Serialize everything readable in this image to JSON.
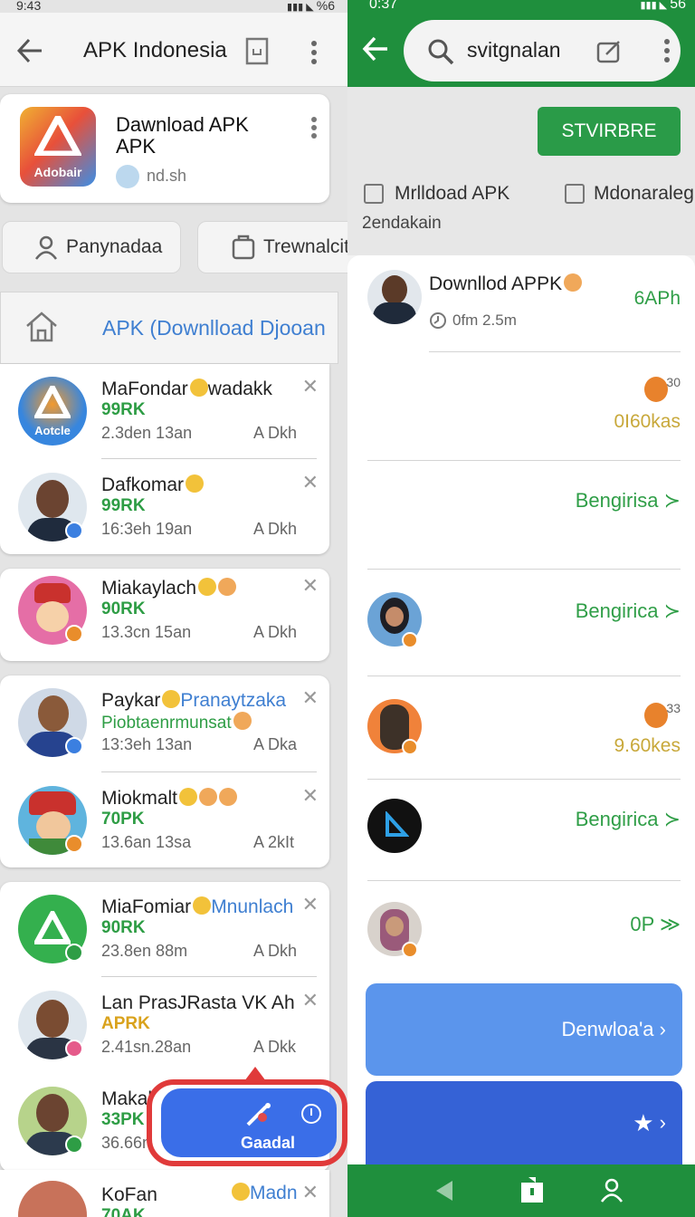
{
  "left": {
    "status": {
      "time": "9:43",
      "battery": "%6"
    },
    "title": "APK Indonesia",
    "top_card": {
      "title_line1": "Dawnload APK",
      "title_line2": "APK",
      "sub": "nd.sh",
      "icon_label": "Adobair"
    },
    "chips": [
      "Panynadaa",
      "Trewnalcit"
    ],
    "section_title": "APK (Downlload Djooan",
    "rows": [
      {
        "name": "MaFondar",
        "name_suffix": "wadakk",
        "sub": "99RK",
        "time": "2.3den 13an",
        "size": "A Dkh",
        "avatar_label": "Aotcle",
        "sub_color": "#2e9d45"
      },
      {
        "name": "Dafkomar",
        "name_suffix": "",
        "sub": "99RK",
        "time": "16:3eh 19an",
        "size": "A Dkh",
        "sub_color": "#2e9d45"
      },
      {
        "name": "Miakaylach",
        "name_suffix": "",
        "sub": "90RK",
        "time": "13.3cn 15an",
        "size": "A Dkh",
        "sub_color": "#2e9d45"
      },
      {
        "name": "Paykar",
        "name_suffix": "Pranaytzaka",
        "sub": "Piobtaenrmunsat",
        "time": "13:3eh 13an",
        "size": "A Dka",
        "sub_color": "#2e9d45"
      },
      {
        "name": "Miokmalt",
        "name_suffix": "",
        "sub": "70PK",
        "time": "13.6an 13sa",
        "size": "A 2kIt",
        "sub_color": "#2e9d45"
      },
      {
        "name": "MiaFomiar",
        "name_suffix": "Mnunlach",
        "sub": "90RK",
        "time": "23.8en 88m",
        "size": "A Dkh",
        "sub_color": "#2e9d45"
      },
      {
        "name": "Lan PrasJRasta VK Ah",
        "name_suffix": "",
        "sub": "APRK",
        "time": "2.41sn.28an",
        "size": "A Dkk",
        "sub_color": "#d9a21c"
      },
      {
        "name": "Makal",
        "name_suffix": "",
        "sub": "33PK",
        "time": "36.66n",
        "size": "",
        "sub_color": "#2e9d45"
      },
      {
        "name": "KoFan",
        "name_suffix": "Madn",
        "sub": "70AK",
        "time": "",
        "size": "",
        "sub_color": "#2e9d45"
      }
    ],
    "fab_label": "Gaadal"
  },
  "right": {
    "status": {
      "time": "0:37",
      "battery": "56"
    },
    "search_value": "svitgnalan",
    "top_button": "STVIRBRE",
    "checks": [
      "Mrlldoad APK",
      "Mdonaraleg"
    ],
    "subtext": "2endakain",
    "item": {
      "title": "Downllod APPK",
      "right": "6APh",
      "meta": "0fm 2.5m"
    },
    "entries": [
      {
        "type": "stat",
        "count": "30",
        "value": "0I60kas"
      },
      {
        "type": "link",
        "label": "Bengirisa"
      },
      {
        "type": "link",
        "label": "Bengirica"
      },
      {
        "type": "stat",
        "count": "33",
        "value": "9.60kes"
      },
      {
        "type": "link",
        "label": "Bengirica"
      },
      {
        "type": "link",
        "label": "0P"
      }
    ],
    "btn_download": "Denwloa'a",
    "nav": [
      "back",
      "home",
      "profile"
    ]
  }
}
